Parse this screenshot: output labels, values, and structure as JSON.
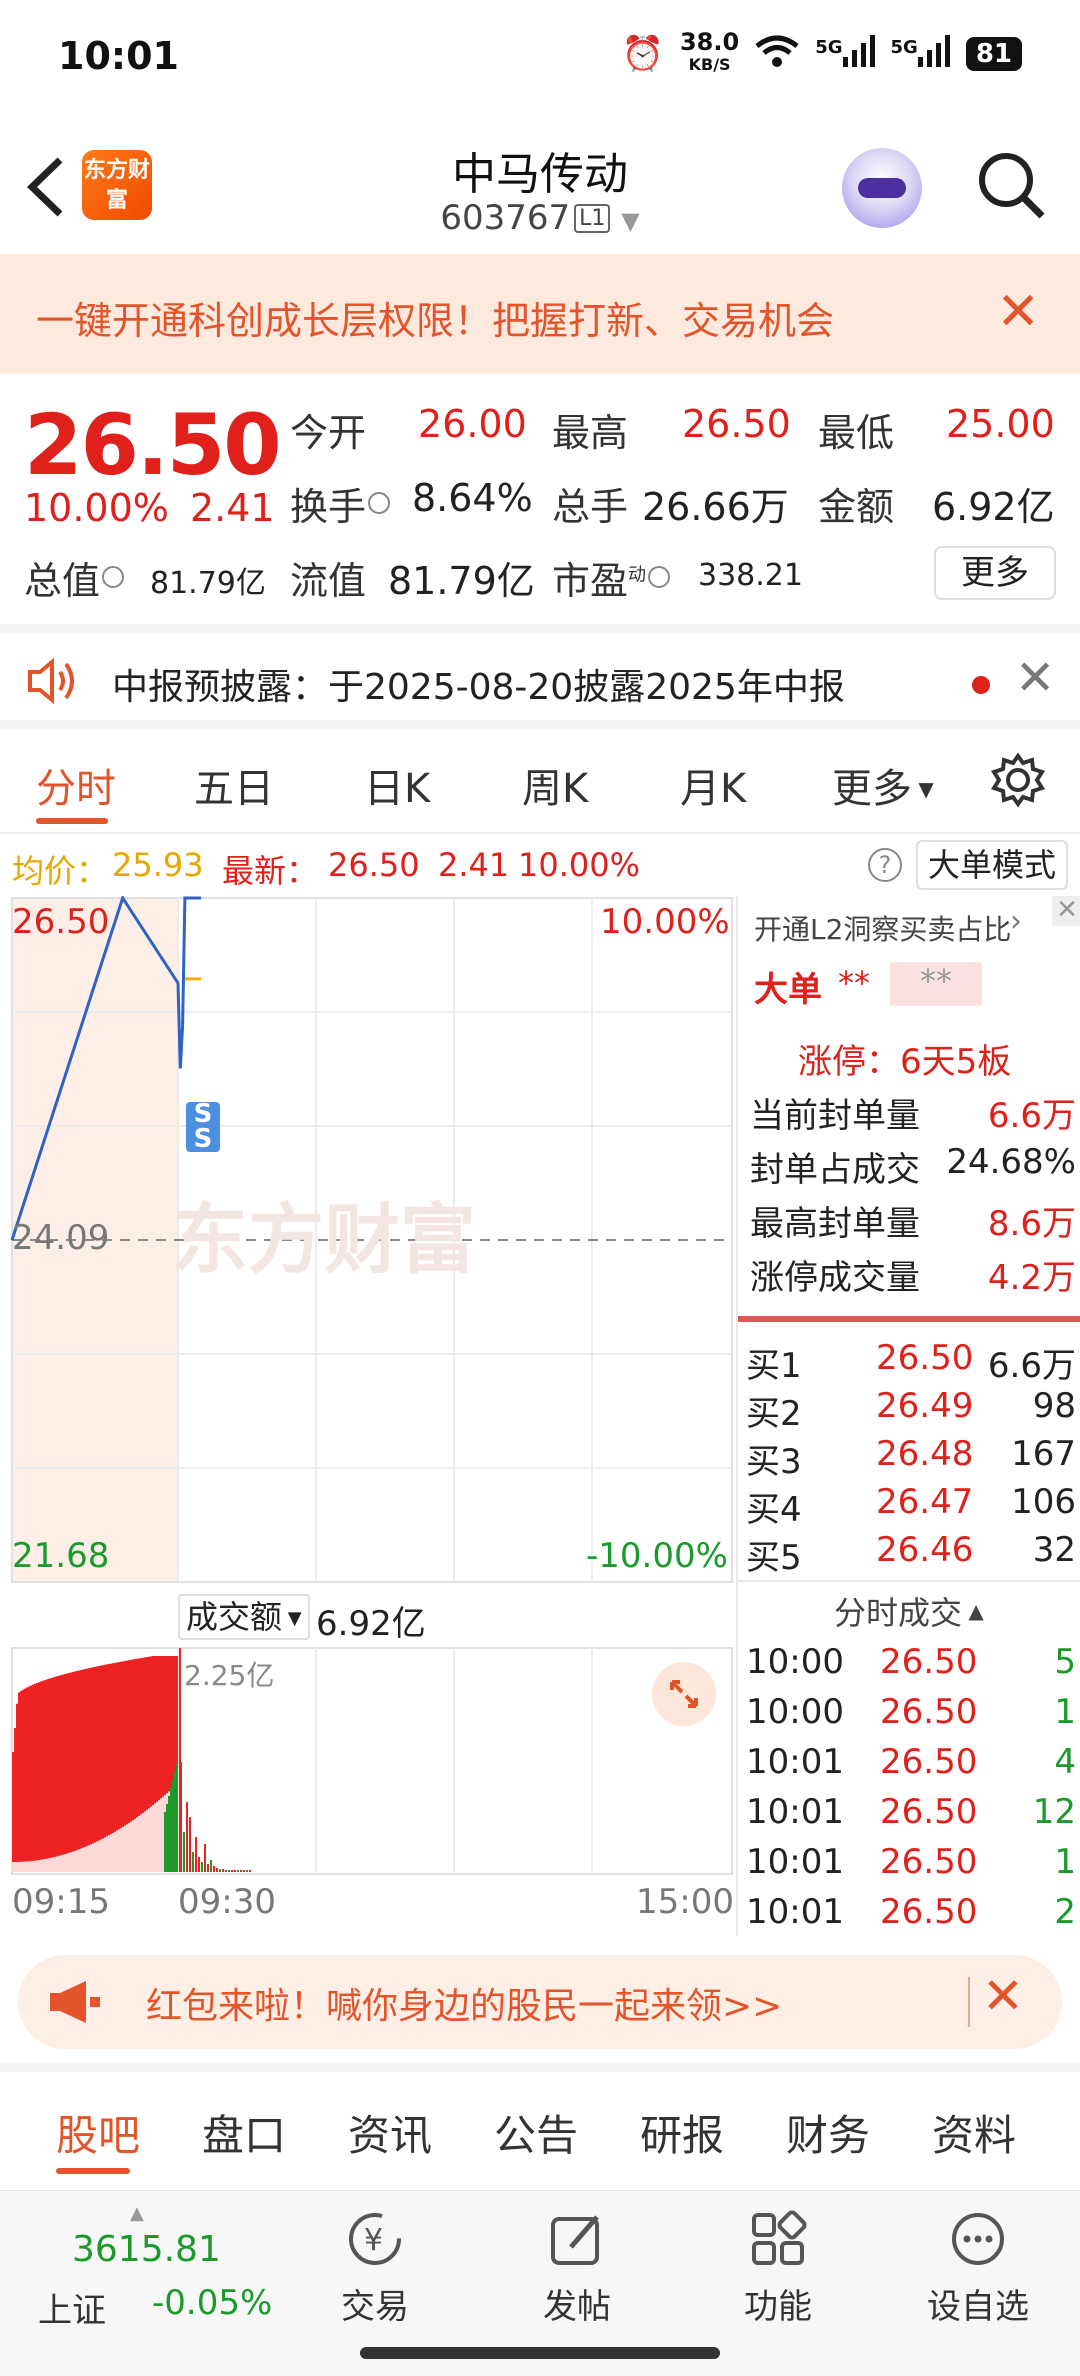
{
  "status": {
    "time": "10:01",
    "net_speed": "38.0",
    "net_unit": "KB/S",
    "sig1": "5G",
    "sig2": "5G",
    "battery": "81"
  },
  "header": {
    "logo_text": "东方财富",
    "name": "中马传动",
    "code": "603767",
    "level": "L1"
  },
  "banner": {
    "text": "一键开通科创成长层权限！把握打新、交易机会"
  },
  "quote": {
    "price": "26.50",
    "change_pct": "10.00%",
    "change": "2.41",
    "open_label": "今开",
    "open": "26.00",
    "high_label": "最高",
    "high": "26.50",
    "low_label": "最低",
    "low": "25.00",
    "turnover_label": "换手",
    "turnover": "8.64%",
    "volume_label": "总手",
    "volume": "26.66万",
    "amount_label": "金额",
    "amount": "6.92亿",
    "mktcap_label": "总值",
    "mktcap": "81.79亿",
    "float_label": "流值",
    "float": "81.79亿",
    "pe_label": "市盈",
    "pe_sup": "动",
    "pe": "338.21",
    "more_label": "更多"
  },
  "notice": {
    "text": "中报预披露：于2025-08-20披露2025年中报"
  },
  "tabs": [
    "分时",
    "五日",
    "日K",
    "周K",
    "月K",
    "更多"
  ],
  "chart_info": {
    "avg_label": "均价：",
    "avg": "25.93",
    "latest_label": "最新：",
    "latest": "26.50",
    "latest_chg": "2.41",
    "latest_pct": "10.00%",
    "mode_label": "大单模式"
  },
  "chart": {
    "price_high": "26.50",
    "pct_high": "10.00%",
    "prev_close": "24.09",
    "price_low": "21.68",
    "pct_low": "-10.00%",
    "watermark": "东方财富",
    "volume_label": "成交额",
    "volume_total": "6.92亿",
    "volume_max": "2.25亿",
    "time_start": "09:15",
    "time_mid": "09:30",
    "time_end": "15:00",
    "marker": "S"
  },
  "chart_data": {
    "type": "line",
    "title": "",
    "xlabel": "",
    "ylabel": "",
    "x_ticks": [
      "09:15",
      "09:30",
      "15:00"
    ],
    "ylim": [
      21.68,
      26.5
    ],
    "prev_close": 24.09,
    "series": [
      {
        "name": "最新",
        "x": [
          "09:15",
          "09:25",
          "09:30",
          "09:31",
          "09:32",
          "09:33",
          "09:35",
          "09:40"
        ],
        "values": [
          24.09,
          26.5,
          25.9,
          25.3,
          25.6,
          26.5,
          26.5,
          26.5
        ]
      },
      {
        "name": "均价",
        "x": [
          "09:33",
          "09:40"
        ],
        "values": [
          25.93,
          25.93
        ]
      }
    ],
    "volume": {
      "label": "成交额",
      "total": "6.92亿",
      "max": "2.25亿"
    }
  },
  "side": {
    "l2_link": "开通L2洞察买卖占比",
    "big_order_label": "大单",
    "big_order_val1": "**",
    "big_order_val2": "**",
    "limit_title": "涨停：6天5板",
    "stats": [
      {
        "label": "当前封单量",
        "value": "6.6万"
      },
      {
        "label": "封单占成交",
        "value": "24.68%"
      },
      {
        "label": "最高封单量",
        "value": "8.6万"
      },
      {
        "label": "涨停成交量",
        "value": "4.2万"
      }
    ],
    "orderbook": [
      {
        "label": "买1",
        "price": "26.50",
        "qty": "6.6万"
      },
      {
        "label": "买2",
        "price": "26.49",
        "qty": "98"
      },
      {
        "label": "买3",
        "price": "26.48",
        "qty": "167"
      },
      {
        "label": "买4",
        "price": "26.47",
        "qty": "106"
      },
      {
        "label": "买5",
        "price": "26.46",
        "qty": "32"
      }
    ],
    "ticks_title": "分时成交",
    "ticks": [
      {
        "time": "10:00",
        "price": "26.50",
        "qty": "5"
      },
      {
        "time": "10:00",
        "price": "26.50",
        "qty": "1"
      },
      {
        "time": "10:01",
        "price": "26.50",
        "qty": "4"
      },
      {
        "time": "10:01",
        "price": "26.50",
        "qty": "12"
      },
      {
        "time": "10:01",
        "price": "26.50",
        "qty": "1"
      },
      {
        "time": "10:01",
        "price": "26.50",
        "qty": "2"
      }
    ]
  },
  "redpack": {
    "text": "红包来啦！喊你身边的股民一起来领>>"
  },
  "bottom_tabs": [
    "股吧",
    "盘口",
    "资讯",
    "公告",
    "研报",
    "财务",
    "资料"
  ],
  "bottombar": {
    "index_value": "3615.81",
    "index_name": "上证",
    "index_change": "-0.05%",
    "trade": "交易",
    "post": "发帖",
    "function": "功能",
    "watchlist": "设自选"
  },
  "colors": {
    "accent": "#e4542a",
    "up": "#e0201b",
    "down": "#1a9a2a",
    "price_line": "#2f63c0",
    "avg_line": "#f0b400"
  }
}
